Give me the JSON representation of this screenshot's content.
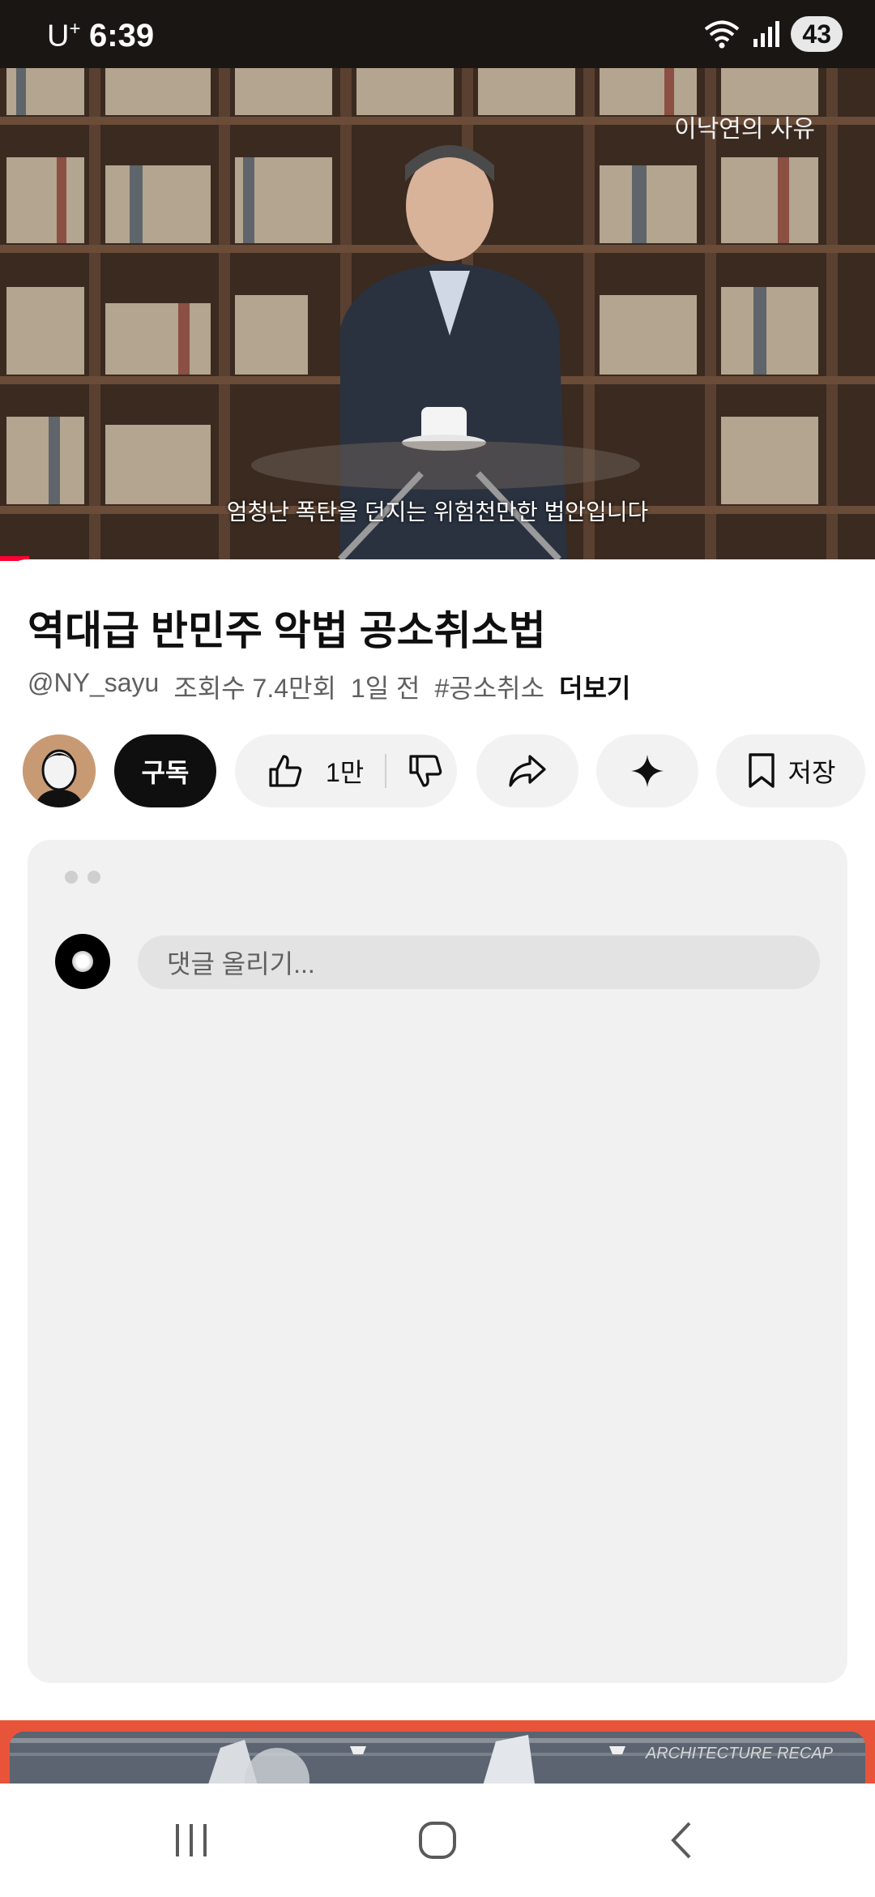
{
  "status_bar": {
    "carrier": "U",
    "carrier_sup": "+",
    "time": "6:39",
    "battery": "43"
  },
  "video": {
    "watermark": "이낙연의 사유",
    "subtitle": "엄청난 폭탄을 던지는 위험천만한 법안입니다",
    "progress_fraction": 0.033
  },
  "title": "역대급 반민주 악법 공소취소법",
  "meta": {
    "channel": "@NY_sayu",
    "views": "조회수 7.4만회",
    "age": "1일 전",
    "hashtag": "#공소취소",
    "more": "더보기"
  },
  "actions": {
    "subscribe": "구독",
    "likes": "1만",
    "save": "저장"
  },
  "comments": {
    "placeholder": "댓글 올리기..."
  },
  "next_video": {
    "caption": "ARCHITECTURE RECAP"
  },
  "colors": {
    "accent_red": "#ff0033",
    "dark": "#0f0f0f",
    "pill_bg": "#f2f2f2",
    "next_video_border": "#e8543a"
  }
}
